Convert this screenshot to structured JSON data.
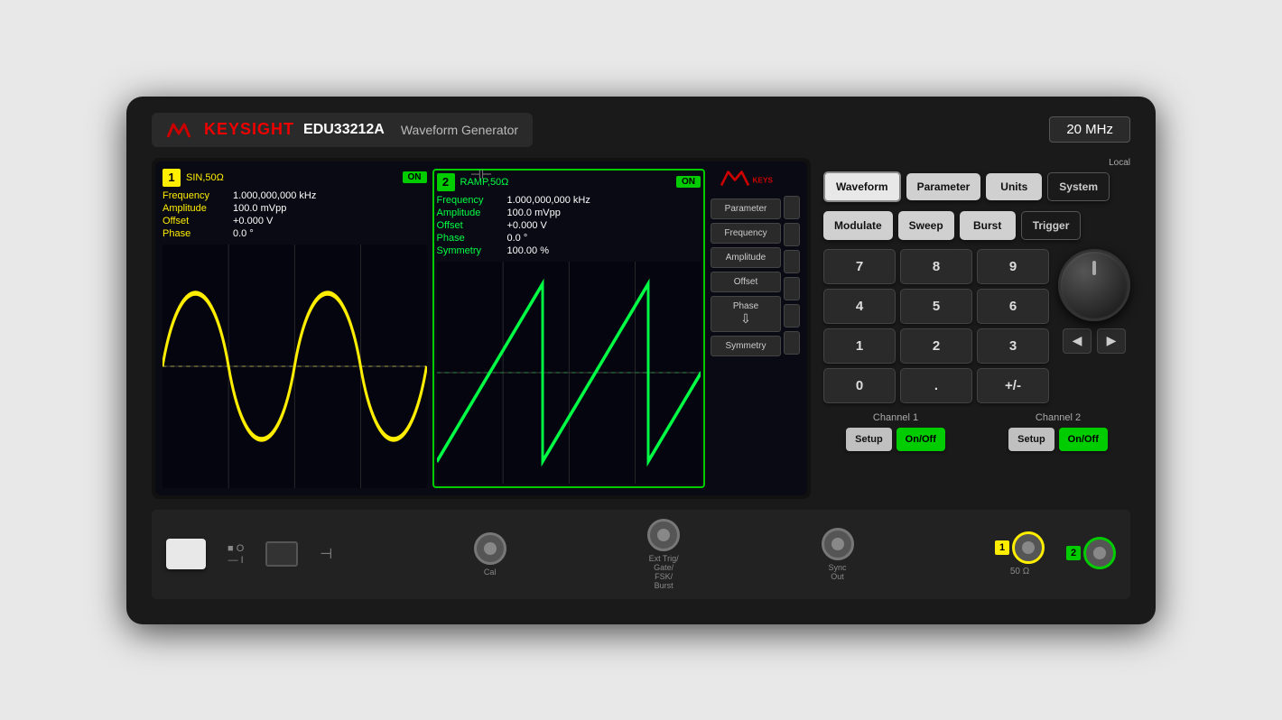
{
  "instrument": {
    "brand": "KEYSIGHT",
    "model": "EDU33212A",
    "type": "Waveform Generator",
    "frequency": "20 MHz"
  },
  "screen": {
    "usb_icon": "⊣",
    "ch1": {
      "number": "1",
      "waveform": "SIN",
      "impedance": "50Ω",
      "on_label": "ON",
      "params": {
        "frequency_label": "Frequency",
        "frequency_value": "1.000,000,000 kHz",
        "amplitude_label": "Amplitude",
        "amplitude_value": "100.0 mVpp",
        "offset_label": "Offset",
        "offset_value": "+0.000 V",
        "phase_label": "Phase",
        "phase_value": "0.0 °"
      }
    },
    "ch2": {
      "number": "2",
      "waveform": "RAMP",
      "impedance": "50Ω",
      "on_label": "ON",
      "params": {
        "frequency_label": "Frequency",
        "frequency_value": "1.000,000,000 kHz",
        "amplitude_label": "Amplitude",
        "amplitude_value": "100.0 mVpp",
        "offset_label": "Offset",
        "offset_value": "+0.000 V",
        "phase_label": "Phase",
        "phase_value": "0.0 °",
        "symmetry_label": "Symmetry",
        "symmetry_value": "100.00 %"
      }
    },
    "menu": {
      "items": [
        "Parameter",
        "Frequency",
        "Amplitude",
        "Offset",
        "Phase",
        "Symmetry"
      ]
    }
  },
  "controls": {
    "row1": {
      "waveform": "Waveform",
      "parameter": "Parameter",
      "units": "Units",
      "system": "System",
      "local_label": "Local"
    },
    "row2": {
      "modulate": "Modulate",
      "sweep": "Sweep",
      "burst": "Burst",
      "trigger": "Trigger"
    },
    "numpad": {
      "keys": [
        "7",
        "8",
        "9",
        "4",
        "5",
        "6",
        "1",
        "2",
        "3",
        "0",
        ".",
        "+/-"
      ]
    },
    "back_btn": "Back",
    "channel1": {
      "label": "Channel 1",
      "setup": "Setup",
      "onoff": "On/Off"
    },
    "channel2": {
      "label": "Channel 2",
      "setup": "Setup",
      "onoff": "On/Off"
    }
  },
  "bottom": {
    "power_label": "",
    "io_label_1": "■ O",
    "io_label_2": "— I",
    "usb_symbol": "⊣",
    "cal_label": "Cal",
    "ext_trig_label": "Ext Trig/\nGate/\nFSK/\nBurst",
    "sync_out_label": "Sync\nOut",
    "ch1_ohm": "50 Ω",
    "ch1_badge": "1",
    "ch2_badge": "2"
  }
}
